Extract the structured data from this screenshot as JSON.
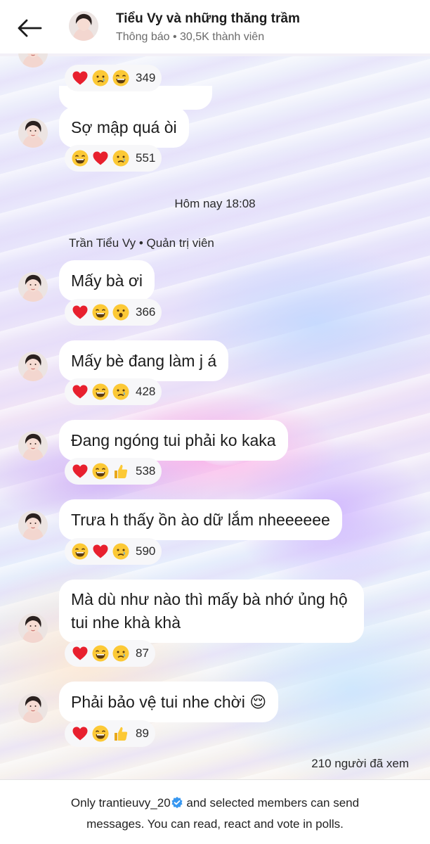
{
  "header": {
    "title": "Tiểu Vy và những thăng trầm",
    "subtitle": "Thông báo • 30,5K thành viên"
  },
  "messages_before": [
    {
      "reactions": [
        "heart",
        "sad",
        "laugh"
      ],
      "count": "349"
    },
    {
      "text": "Sợ mập quá òi",
      "reactions": [
        "laugh",
        "heart",
        "sad"
      ],
      "count": "551"
    }
  ],
  "divider": "Hôm nay 18:08",
  "sender": "Trần Tiểu Vy • Quản trị viên",
  "messages": [
    {
      "text": "Mấy bà ơi",
      "reactions": [
        "heart",
        "laugh",
        "wow"
      ],
      "count": "366"
    },
    {
      "text": "Mấy bè đang làm j á",
      "reactions": [
        "heart",
        "laugh",
        "sad"
      ],
      "count": "428"
    },
    {
      "text": "Đang ngóng tui phải ko kaka",
      "reactions": [
        "heart",
        "laugh",
        "like"
      ],
      "count": "538"
    },
    {
      "text": "Trưa h thấy ồn ào dữ lắm nheeeeee",
      "reactions": [
        "laugh",
        "heart",
        "sad"
      ],
      "count": "590"
    },
    {
      "text": "Mà dù như nào thì mấy bà nhớ ủng hộ tui nhe khà khà",
      "reactions": [
        "heart",
        "laugh",
        "sad"
      ],
      "count": "87"
    },
    {
      "text": "Phải bảo vệ tui nhe chời 😌",
      "reactions": [
        "heart",
        "laugh",
        "like"
      ],
      "count": "89"
    }
  ],
  "views": "210 người đã xem",
  "footer": {
    "before": "Only trantieuvy_20",
    "after": " and selected members can send",
    "line2": "messages. You can read, react and vote in polls."
  },
  "colors": {
    "heart": "#e8202e",
    "emoji_face": "#fcc936",
    "verified": "#3797f0"
  }
}
